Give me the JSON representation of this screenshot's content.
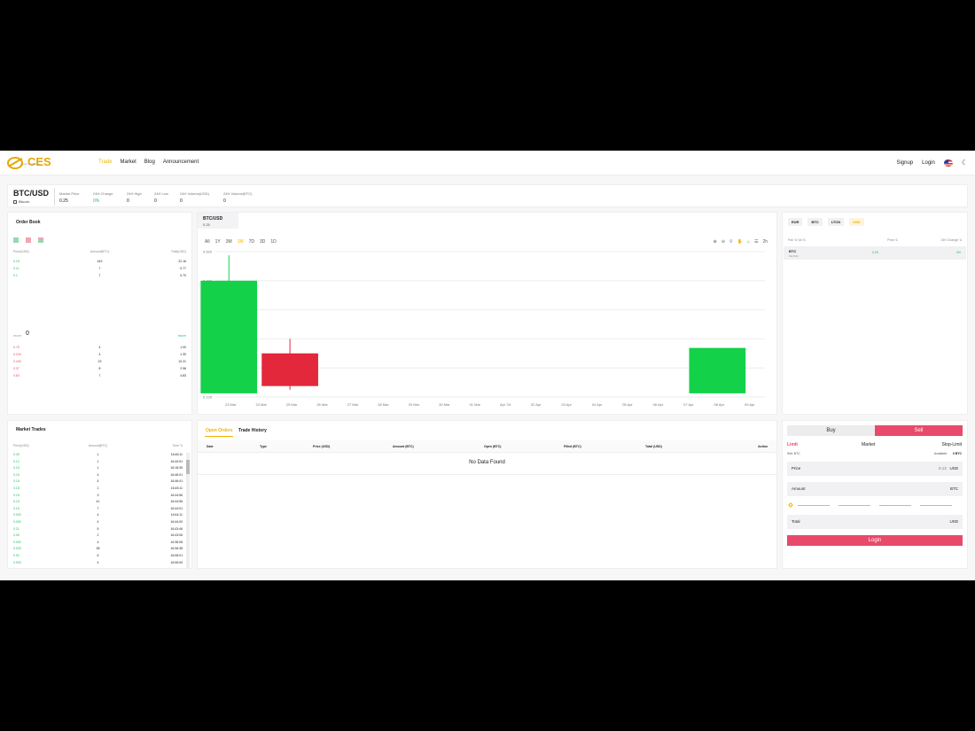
{
  "app": {
    "logo_text": "CES",
    "logo_sub": "crypto exchange",
    "nav": [
      "Trade",
      "Market",
      "Blog",
      "Announcement"
    ],
    "active_nav": "Trade",
    "signup": "Signup",
    "login": "Login"
  },
  "ticker": {
    "pair": "BTC/USD",
    "coin": "Bitcoin",
    "stats": [
      {
        "label": "Market Price",
        "value": "0.25"
      },
      {
        "label": "24H Change",
        "value": "0%"
      },
      {
        "label": "24H High",
        "value": "0"
      },
      {
        "label": "24H Low",
        "value": "0"
      },
      {
        "label": "24H Volume(USD)",
        "value": "0"
      },
      {
        "label": "24H Volume(BTC)",
        "value": "0"
      }
    ]
  },
  "order_book": {
    "title": "Order Book",
    "headers": [
      "Price(USD)",
      "Amount(BTC)",
      "Total(USD)"
    ],
    "buys": [
      [
        "0.15",
        "443",
        "22.16"
      ],
      [
        "0.11",
        "7",
        "0.77"
      ],
      [
        "0.1",
        "7",
        "0.70"
      ]
    ],
    "mid_label": "more",
    "mid_value": "0",
    "mid_link": "more",
    "sells": [
      [
        "0.75",
        "4",
        "1.00"
      ],
      [
        "0.104",
        "4",
        "1.30"
      ],
      [
        "0.443",
        "23",
        "10.21"
      ],
      [
        "0.37",
        "8",
        "2.96"
      ],
      [
        "0.63",
        "7",
        "4.83"
      ]
    ]
  },
  "chart_panel": {
    "pair": "BTC/USD",
    "price": "0.25",
    "ranges": [
      "All",
      "1Y",
      "3M",
      "1M",
      "7D",
      "3D",
      "1D"
    ],
    "active_range": "1M",
    "interval": "2h"
  },
  "chart_data": {
    "type": "candlestick",
    "x": [
      "23 Mar",
      "24 Mar",
      "25 Mar",
      "26 Mar",
      "27 Mar",
      "28 Mar",
      "29 Mar",
      "30 Mar",
      "31 Mar",
      "Apr '24",
      "02 Apr",
      "03 Apr",
      "04 Apr",
      "05 Apr",
      "06 Apr",
      "07 Apr",
      "08 Apr",
      "09 Apr"
    ],
    "y_ticks": [
      "0.520",
      "0.446",
      "0.363",
      "0.282",
      "0.201",
      "0.129"
    ],
    "ylim": [
      0.12,
      0.52
    ],
    "candles": [
      {
        "x": "23 Mar",
        "open": 0.13,
        "close": 0.44,
        "high": 0.51,
        "low": 0.13
      },
      {
        "x": "25 Mar",
        "open": 0.24,
        "close": 0.15,
        "high": 0.28,
        "low": 0.14
      },
      {
        "x": "08 Apr",
        "open": 0.13,
        "close": 0.255,
        "high": 0.255,
        "low": 0.13
      }
    ],
    "colors": {
      "up": "#14d14a",
      "down": "#e3283c"
    }
  },
  "markets": {
    "tabs": [
      "EUR",
      "BTC",
      "LTCN",
      "USD"
    ],
    "active_tab": "USD",
    "headers": [
      "Pair ⇅ Vol ⇅",
      "Price ⇅",
      "24H Change ⇅"
    ],
    "rows": [
      {
        "pair": "BTC",
        "vol": "Vol:0.01",
        "price": "0.25",
        "change": "0%"
      }
    ]
  },
  "market_trades": {
    "title": "Market Trades",
    "headers": [
      "Price(USD)",
      "Amount(BTC)",
      "Time ⇅"
    ],
    "rows": [
      [
        "0.25",
        "1",
        "16:46:11"
      ],
      [
        "0.12",
        "1",
        "16:40:51"
      ],
      [
        "0.15",
        "1",
        "16:18:35"
      ],
      [
        "0.15",
        "4",
        "16:46:01"
      ],
      [
        "0.15",
        "4",
        "16:46:41"
      ],
      [
        "0.15",
        "1",
        "16:45:11"
      ],
      [
        "0.15",
        "3",
        "16:44:56"
      ],
      [
        "0.15",
        "41",
        "16:44:56"
      ],
      [
        "0.15",
        "7",
        "16:44:01"
      ],
      [
        "0.002",
        "4",
        "16:44:11"
      ],
      [
        "0.002",
        "4",
        "16:44:00"
      ],
      [
        "0.21",
        "5",
        "16:43:46"
      ],
      [
        "0.05",
        "2",
        "16:43:06"
      ],
      [
        "0.002",
        "4",
        "16:38:08"
      ],
      [
        "0.003",
        "38",
        "16:36:38"
      ],
      [
        "0.02",
        "6",
        "16:08:01"
      ],
      [
        "0.003",
        "4",
        "16:06:00"
      ]
    ]
  },
  "orders": {
    "tabs": [
      "Open Orders",
      "Trade History"
    ],
    "active_tab": "Open Orders",
    "headers": [
      "Date",
      "Type",
      "Price (USD)",
      "Amount (BTC)",
      "Open (BTC)",
      "Filled (BTC)",
      "Total (USD)",
      "Action"
    ],
    "empty": "No Data Found"
  },
  "trade_form": {
    "buy": "Buy",
    "sell": "Sell",
    "types": [
      "Limit",
      "Market",
      "Stop-Limit"
    ],
    "active_type": "Limit",
    "sell_label": "Sell: BTC",
    "available": "Available:",
    "available_value": "0 BTC",
    "price_label": "Price",
    "price_value": "0.13",
    "price_unit": "USD",
    "amount_label": "Amount",
    "amount_unit": "BTC",
    "total_label": "Total",
    "total_unit": "USD",
    "login": "Login"
  }
}
